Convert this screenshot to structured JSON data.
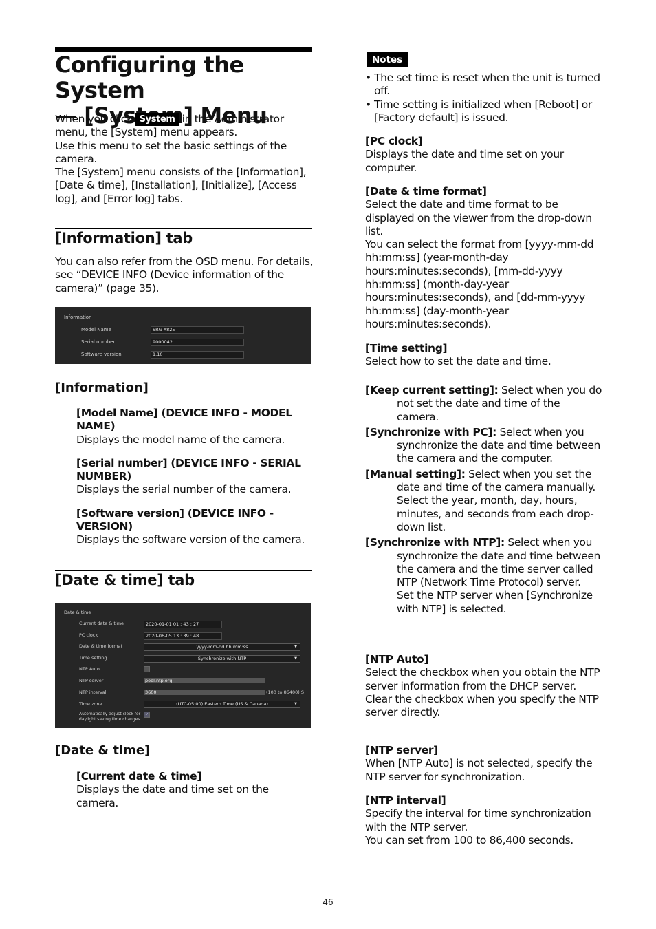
{
  "page": {
    "title_line1": "Configuring the System",
    "title_line2": "— [System] Menu",
    "intro_before_button": "When you click",
    "system_button_label": "System",
    "intro_after_button": "in the Administrator menu, the [System] menu appears.",
    "intro_p2": "Use this menu to set the basic settings of the camera.",
    "intro_p3": "The [System] menu consists of the [Information], [Date & time], [Installation], [Initialize], [Access log], and [Error log] tabs.",
    "page_number": "46"
  },
  "information_tab": {
    "heading": "[Information] tab",
    "body": "You can also refer from the OSD menu. For details, see “DEVICE INFO (Device information of the camera)” (page 35).",
    "screenshot": {
      "title": "Information",
      "rows": [
        {
          "label": "Model Name",
          "value": "SRG-X825"
        },
        {
          "label": "Serial number",
          "value": "9000042"
        },
        {
          "label": "Software version",
          "value": "1.10"
        }
      ]
    },
    "subheading": "[Information]",
    "items": [
      {
        "term": "[Model Name] (DEVICE INFO - MODEL NAME)",
        "desc": "Displays the model name of the camera."
      },
      {
        "term": "[Serial number] (DEVICE INFO - SERIAL NUMBER)",
        "desc": "Displays the serial number of the camera."
      },
      {
        "term": "[Software version] (DEVICE INFO - VERSION)",
        "desc": "Displays the software version of the camera."
      }
    ]
  },
  "datetime_tab": {
    "heading": "[Date & time] tab",
    "screenshot": {
      "title": "Date & time",
      "current_label": "Current date & time",
      "current_value": "2020-01-01  01 : 43 : 27",
      "pc_label": "PC clock",
      "pc_value": "2020-06-05  13 : 39 : 48",
      "format_label": "Date & time format",
      "format_value": "yyyy-mm-dd hh:mm:ss",
      "setting_label": "Time setting",
      "setting_value": "Synchronize with NTP",
      "ntp_auto_label": "NTP Auto",
      "ntp_auto_checked": false,
      "ntp_server_label": "NTP server",
      "ntp_server_value": "pool.ntp.org",
      "ntp_interval_label": "NTP interval",
      "ntp_interval_value": "3600",
      "ntp_interval_range": "(100 to 86400) S",
      "timezone_label": "Time zone",
      "timezone_value": "(UTC-05:00) Eastern Time (US & Canada)",
      "dst_label": "Automatically adjust clock for daylight saving time changes",
      "dst_checked": true,
      "check_glyph": "✓",
      "dropdown_glyph": "▼"
    },
    "subheading": "[Date & time]",
    "current_term": "[Current date & time]",
    "current_desc": "Displays the date and time set on the camera."
  },
  "right": {
    "notes_label": "Notes",
    "notes": [
      "The set time is reset when the unit is turned off.",
      "Time setting is initialized when [Reboot] or [Factory default] is issued."
    ],
    "pc_clock_term": "[PC clock]",
    "pc_clock_desc": "Displays the date and time set on your computer.",
    "format_term": "[Date & time format]",
    "format_desc1": "Select the date and time format to be displayed on the viewer from the drop-down list.",
    "format_desc2": "You can select the format from [yyyy-mm-dd hh:mm:ss] (year-month-day hours:minutes:seconds), [mm-dd-yyyy hh:mm:ss] (month-day-year hours:minutes:seconds), and [dd-mm-yyyy hh:mm:ss] (day-month-year hours:minutes:seconds).",
    "setting_term": "[Time setting]",
    "setting_desc": "Select how to set the date and time.",
    "options": [
      {
        "term": "[Keep current setting]:",
        "desc": "Select when you do not set the date and time of the camera."
      },
      {
        "term": "[Synchronize with PC]:",
        "desc": "Select when you synchronize the date and time between the camera and the computer."
      },
      {
        "term": "[Manual setting]:",
        "desc": "Select when you set the date and time of the camera manually. Select the year, month, day, hours, minutes, and seconds from each drop-down list."
      },
      {
        "term": "[Synchronize with NTP]:",
        "desc": "Select when you synchronize the date and time between the camera and the time server called NTP (Network Time Protocol) server.",
        "desc2": "Set the NTP server when [Synchronize with NTP] is selected."
      }
    ],
    "ntp_auto_term": "[NTP Auto]",
    "ntp_auto_desc1": "Select the checkbox when you obtain the NTP server information from the DHCP server.",
    "ntp_auto_desc2": "Clear the checkbox when you specify the NTP server directly.",
    "ntp_server_term": "[NTP server]",
    "ntp_server_desc": "When [NTP Auto] is not selected, specify the NTP server for synchronization.",
    "ntp_interval_term": "[NTP interval]",
    "ntp_interval_desc1": "Specify the interval for time synchronization with the NTP server.",
    "ntp_interval_desc2": "You can set from 100 to 86,400 seconds."
  }
}
